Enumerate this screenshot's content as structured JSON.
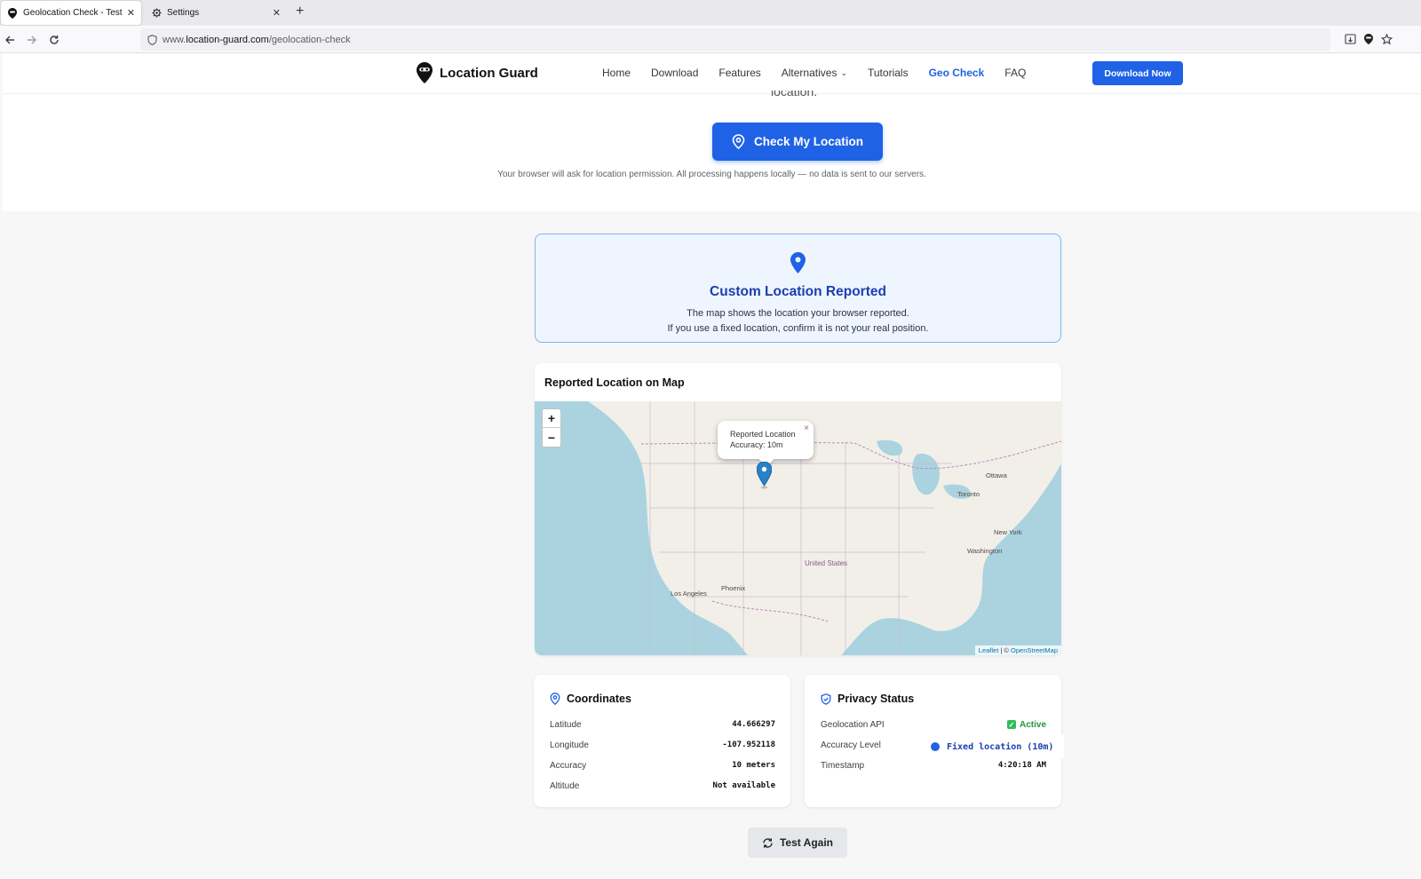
{
  "browser": {
    "tabs": [
      {
        "title": "Geolocation Check - Test Wh",
        "active": true
      },
      {
        "title": "Settings",
        "active": false
      }
    ],
    "url_prefix": "www.",
    "url_host": "location-guard.com",
    "url_path": "/geolocation-check"
  },
  "header": {
    "brand": "Location Guard",
    "menu": [
      "Home",
      "Download",
      "Features",
      "Alternatives",
      "Tutorials",
      "Geo Check",
      "FAQ"
    ],
    "active_menu": "Geo Check",
    "cta": "Download Now"
  },
  "hero": {
    "cut_text": "location.",
    "check_button": "Check My Location",
    "note": "Your browser will ask for location permission. All processing happens locally — no data is sent to our servers."
  },
  "alert": {
    "title": "Custom Location Reported",
    "line1": "The map shows the location your browser reported.",
    "line2": "If you use a fixed location, confirm it is not your real position."
  },
  "map": {
    "title": "Reported Location on Map",
    "zoom_in": "+",
    "zoom_out": "−",
    "popup_line1": "Reported Location",
    "popup_line2": "Accuracy: 10m",
    "popup_close": "×",
    "cities": [
      "Ottawa",
      "Toronto",
      "New York",
      "Washington",
      "Los Angeles",
      "Phoenix"
    ],
    "country": "United States",
    "attribution_leaflet": "Leaflet",
    "attribution_sep": " | © ",
    "attribution_osm": "OpenStreetMap",
    "colors": {
      "water": "#aad3df",
      "land": "#f2efe9"
    }
  },
  "coordinates": {
    "title": "Coordinates",
    "rows": [
      {
        "label": "Latitude",
        "value": "44.666297"
      },
      {
        "label": "Longitude",
        "value": "-107.952118"
      },
      {
        "label": "Accuracy",
        "value": "10 meters"
      },
      {
        "label": "Altitude",
        "value": "Not available"
      }
    ]
  },
  "privacy": {
    "title": "Privacy Status",
    "api_label": "Geolocation API",
    "api_value": "Active",
    "accuracy_label": "Accuracy Level",
    "accuracy_value": "Fixed location (10m)",
    "timestamp_label": "Timestamp",
    "timestamp_value": "4:20:18 AM"
  },
  "actions": {
    "test_again": "Test Again"
  },
  "colors": {
    "primary": "#1f62e6",
    "success": "#1a9a3d",
    "alert_border": "#7fb3ee"
  }
}
